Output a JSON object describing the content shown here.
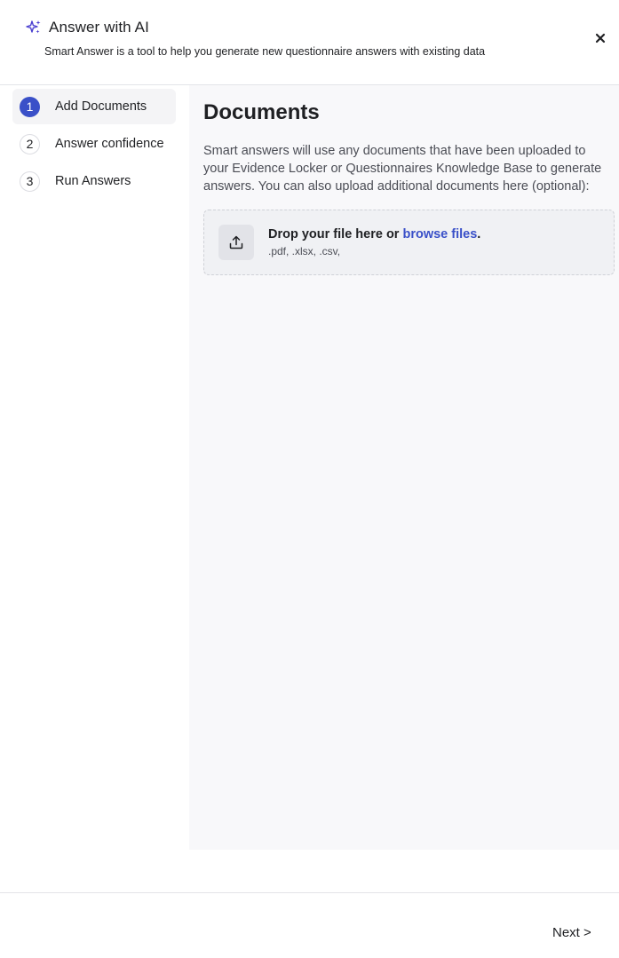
{
  "header": {
    "title": "Answer with AI",
    "subtitle": "Smart Answer is a tool to help you generate new questionnaire answers with existing data",
    "close_icon": "close-icon",
    "title_icon": "sparkle-icon",
    "accent_color": "#4a3fd0"
  },
  "stepper": {
    "steps": [
      {
        "number": "1",
        "label": "Add Documents",
        "active": true
      },
      {
        "number": "2",
        "label": "Answer confidence",
        "active": false
      },
      {
        "number": "3",
        "label": "Run Answers",
        "active": false
      }
    ],
    "active_color": "#3a50c8"
  },
  "main": {
    "title": "Documents",
    "description": "Smart answers will use any documents that have been uploaded to your Evidence Locker or Questionnaires Knowledge Base to generate answers. You can also upload additional documents here (optional):",
    "dropzone": {
      "text_prefix": "Drop your file here or ",
      "link": "browse files",
      "text_suffix": ".",
      "file_types": ".pdf, .xlsx, .csv,",
      "icon": "upload-icon"
    }
  },
  "footer": {
    "next_label": "Next >"
  }
}
